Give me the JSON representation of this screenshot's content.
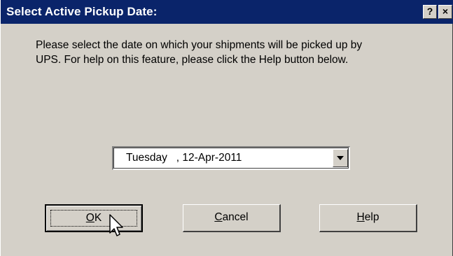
{
  "window": {
    "title": "Select Active Pickup Date:",
    "help_glyph": "?",
    "close_glyph": "×"
  },
  "prompt": {
    "text": "Please select the date on which your shipments will be picked up by\nUPS.  For help on this feature, please click the Help button below."
  },
  "date_select": {
    "value": "Tuesday   , 12-Apr-2011"
  },
  "buttons": {
    "ok": {
      "mnemonic": "O",
      "rest": "K"
    },
    "cancel": {
      "mnemonic": "C",
      "rest": "ancel"
    },
    "help": {
      "mnemonic": "H",
      "rest": "elp"
    }
  },
  "icons": {
    "dropdown": "triangle-down-icon",
    "cursor": "arrow-pointer-icon"
  },
  "colors": {
    "titlebar": "#0a246a",
    "dialog_face": "#d4d0c8",
    "field_bg": "#ffffff"
  }
}
